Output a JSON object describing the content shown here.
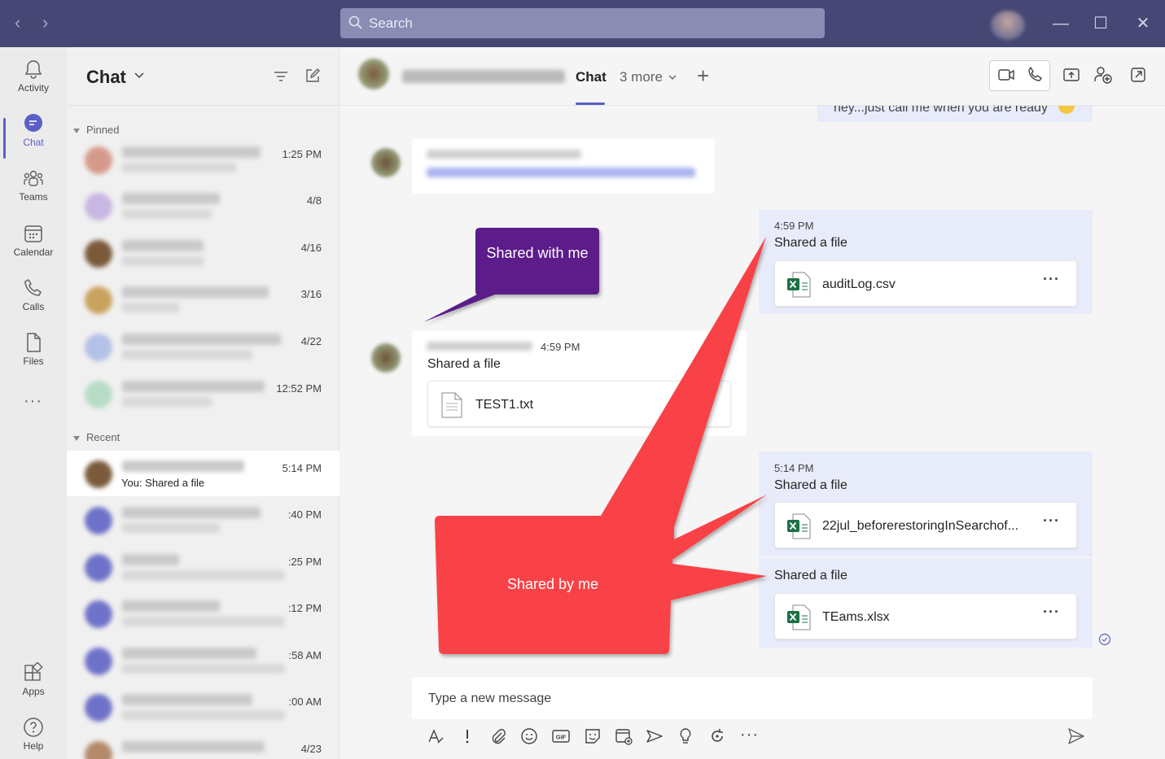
{
  "titlebar": {
    "back": "‹",
    "forward": "›",
    "search_placeholder": "Search",
    "minimize": "—",
    "maximize": "☐",
    "close": "✕"
  },
  "rail": [
    {
      "label": "Activity",
      "icon": "bell-icon"
    },
    {
      "label": "Chat",
      "icon": "chat-icon"
    },
    {
      "label": "Teams",
      "icon": "teams-icon"
    },
    {
      "label": "Calendar",
      "icon": "calendar-icon"
    },
    {
      "label": "Calls",
      "icon": "phone-icon"
    },
    {
      "label": "Files",
      "icon": "file-icon"
    },
    {
      "label": "Apps",
      "icon": "apps-icon"
    },
    {
      "label": "Help",
      "icon": "help-icon"
    }
  ],
  "list": {
    "title": "Chat",
    "pinned_label": "Pinned",
    "recent_label": "Recent",
    "pinned": [
      {
        "time": "1:25 PM"
      },
      {
        "time": "4/8"
      },
      {
        "time": "4/16"
      },
      {
        "time": "3/16"
      },
      {
        "time": "4/22"
      },
      {
        "time": "12:52 PM"
      }
    ],
    "recent": [
      {
        "time": "5:14 PM",
        "preview": "You: Shared a file"
      },
      {
        "time": ":40 PM"
      },
      {
        "time": ":25 PM"
      },
      {
        "time": ":12 PM"
      },
      {
        "time": ":58 AM"
      },
      {
        "time": ":00 AM"
      },
      {
        "time": "4/23"
      }
    ]
  },
  "header": {
    "tab_chat": "Chat",
    "tab_more": "3 more",
    "add": "+"
  },
  "messages": {
    "top_partial": "hey...just call me when you are ready",
    "mine_1": {
      "time": "4:59 PM",
      "text": "Shared a file",
      "file": "auditLog.csv"
    },
    "theirs_1": {
      "time": "4:59 PM",
      "text": "Shared a file",
      "file": "TEST1.txt"
    },
    "mine_2": {
      "time": "5:14 PM",
      "text": "Shared a file",
      "file": "22jul_beforerestoringInSearchof..."
    },
    "mine_3": {
      "text": "Shared a file",
      "file": "TEams.xlsx"
    },
    "more_glyph": "···"
  },
  "callouts": {
    "shared_with_me": "Shared with me",
    "shared_by_me": "Shared by me",
    "purple": "#5c1f8a",
    "red": "#f94346"
  },
  "compose": {
    "placeholder": "Type a new message"
  },
  "colors": {
    "titlebar": "#464775",
    "accent": "#5b5fc7",
    "excel": "#1e7145"
  }
}
